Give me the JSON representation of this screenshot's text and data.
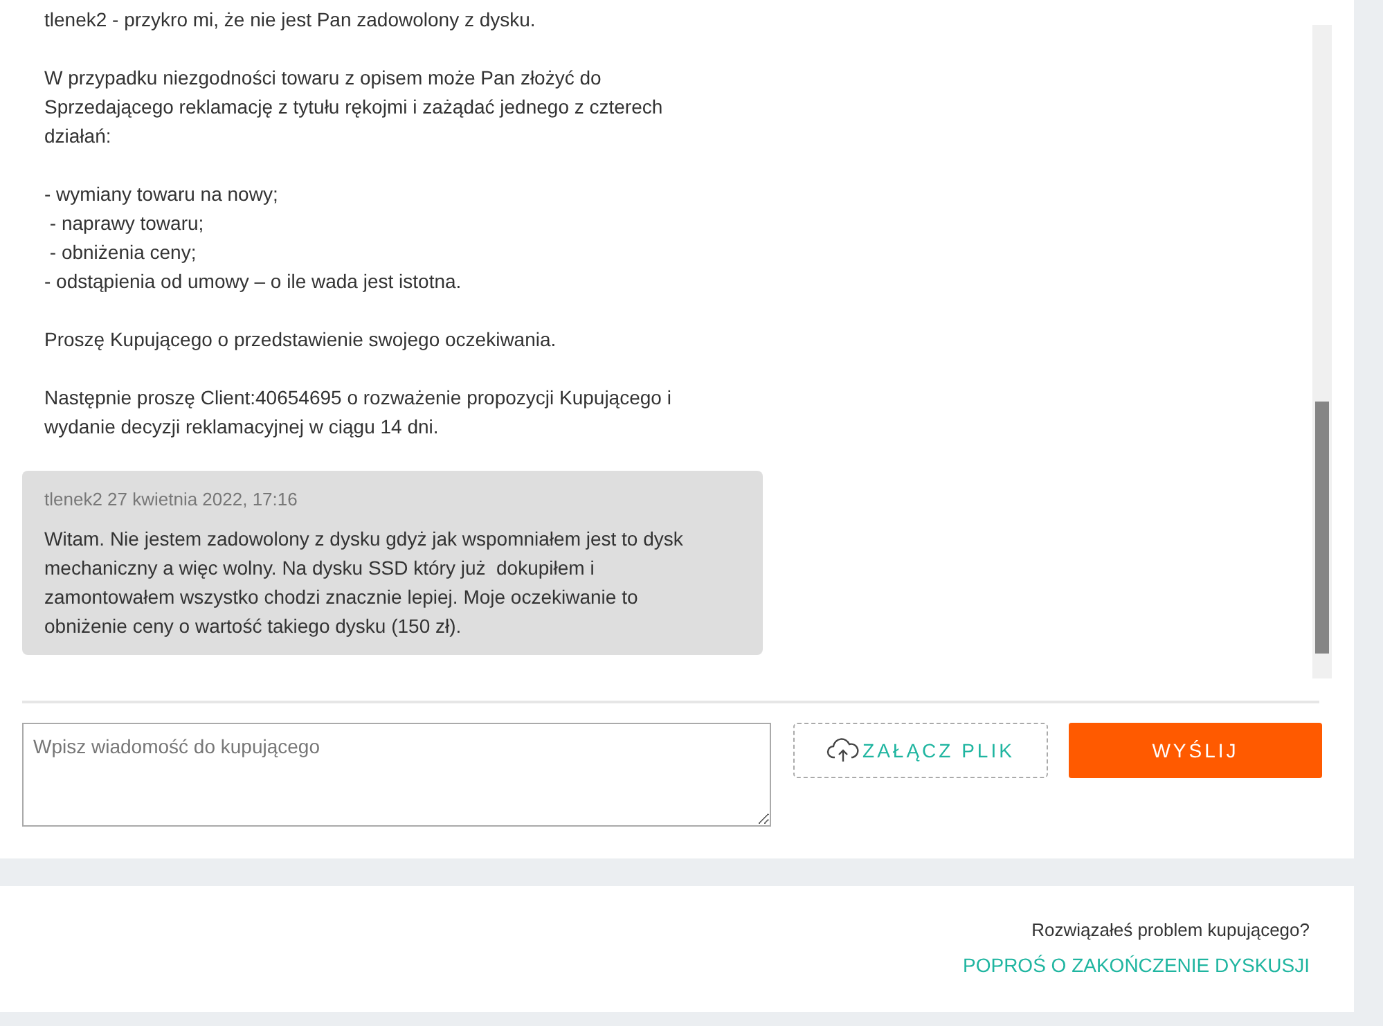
{
  "conversation": {
    "messages": [
      {
        "kind": "plain",
        "paragraphs": [
          "tlenek2 - przykro mi, że nie jest Pan zadowolony z dysku.",
          "W przypadku niezgodności towaru z opisem może Pan złożyć do Sprzedającego reklamację z tytułu rękojmi i zażądać jednego z czterech działań:",
          "- wymiany towaru na nowy;\n - naprawy towaru;\n - obniżenia ceny;\n- odstąpienia od umowy – o ile wada jest istotna.",
          "Proszę Kupującego o przedstawienie swojego oczekiwania.",
          "Następnie proszę Client:40654695 o rozważenie propozycji Kupującego i wydanie decyzji reklamacyjnej w ciągu 14 dni."
        ]
      },
      {
        "kind": "bubble",
        "meta": "tlenek2 27 kwietnia 2022, 17:16",
        "paragraphs": [
          "Witam. Nie jestem zadowolony z dysku gdyż jak wspomniałem jest to dysk mechaniczny a więc wolny. Na dysku SSD który już  dokupiłem i zamontowałem wszystko chodzi znacznie lepiej. Moje oczekiwanie to obniżenie ceny o wartość takiego dysku (150 zł)."
        ]
      }
    ]
  },
  "composer": {
    "placeholder": "Wpisz wiadomość do kupującego",
    "attach_button": "ZAŁĄCZ PLIK",
    "send_button": "WYŚLIJ"
  },
  "footer": {
    "question": "Rozwiązałeś problem kupującego?",
    "link": "POPROŚ O ZAKOŃCZENIE DYSKUSJI"
  }
}
